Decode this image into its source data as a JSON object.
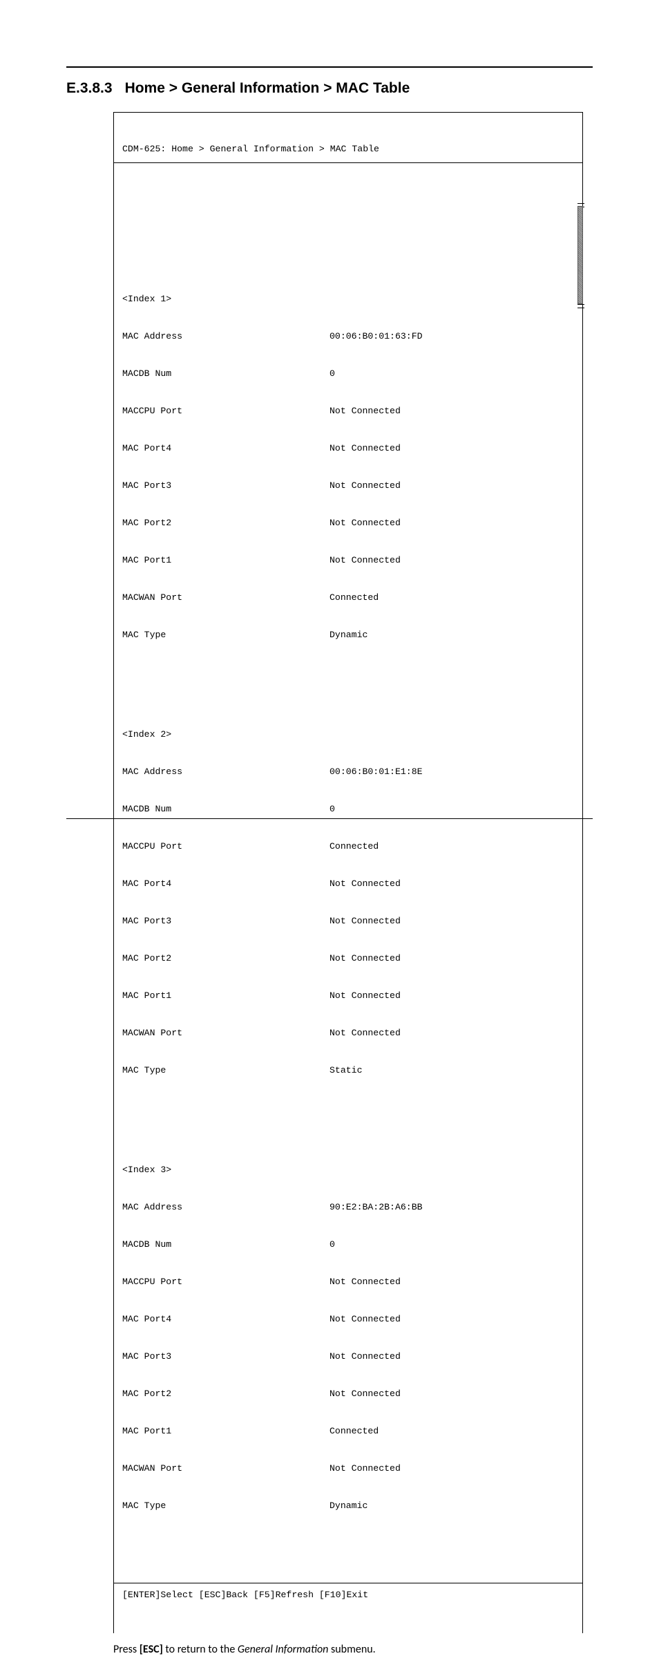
{
  "heading": {
    "number": "E.3.8.3",
    "title": "Home > General Information > MAC Table"
  },
  "terminal": {
    "header": "CDM-625: Home > General Information > MAC Table",
    "entries": [
      {
        "index_label": "<Index 1>",
        "rows": [
          {
            "label": "MAC Address",
            "value": "00:06:B0:01:63:FD"
          },
          {
            "label": "MACDB Num",
            "value": "0"
          },
          {
            "label": "MACCPU Port",
            "value": "Not Connected"
          },
          {
            "label": "MAC Port4",
            "value": "Not Connected"
          },
          {
            "label": "MAC Port3",
            "value": "Not Connected"
          },
          {
            "label": "MAC Port2",
            "value": "Not Connected"
          },
          {
            "label": "MAC Port1",
            "value": "Not Connected"
          },
          {
            "label": "MACWAN Port",
            "value": "Connected"
          },
          {
            "label": "MAC Type",
            "value": "Dynamic"
          }
        ]
      },
      {
        "index_label": "<Index 2>",
        "rows": [
          {
            "label": "MAC Address",
            "value": "00:06:B0:01:E1:8E"
          },
          {
            "label": "MACDB Num",
            "value": "0"
          },
          {
            "label": "MACCPU Port",
            "value": "Connected"
          },
          {
            "label": "MAC Port4",
            "value": "Not Connected"
          },
          {
            "label": "MAC Port3",
            "value": "Not Connected"
          },
          {
            "label": "MAC Port2",
            "value": "Not Connected"
          },
          {
            "label": "MAC Port1",
            "value": "Not Connected"
          },
          {
            "label": "MACWAN Port",
            "value": "Not Connected"
          },
          {
            "label": "MAC Type",
            "value": "Static"
          }
        ]
      },
      {
        "index_label": "<Index 3>",
        "rows": [
          {
            "label": "MAC Address",
            "value": "90:E2:BA:2B:A6:BB"
          },
          {
            "label": "MACDB Num",
            "value": "0"
          },
          {
            "label": "MACCPU Port",
            "value": "Not Connected"
          },
          {
            "label": "MAC Port4",
            "value": "Not Connected"
          },
          {
            "label": "MAC Port3",
            "value": "Not Connected"
          },
          {
            "label": "MAC Port2",
            "value": "Not Connected"
          },
          {
            "label": "MAC Port1",
            "value": "Connected"
          },
          {
            "label": "MACWAN Port",
            "value": "Not Connected"
          },
          {
            "label": "MAC Type",
            "value": "Dynamic"
          }
        ]
      }
    ],
    "footer": "[ENTER]Select [ESC]Back [F5]Refresh [F10]Exit"
  },
  "caption": {
    "pre": "Press ",
    "key": "[ESC]",
    "mid": " to return to the ",
    "ital": "General Information",
    "post": " submenu."
  }
}
